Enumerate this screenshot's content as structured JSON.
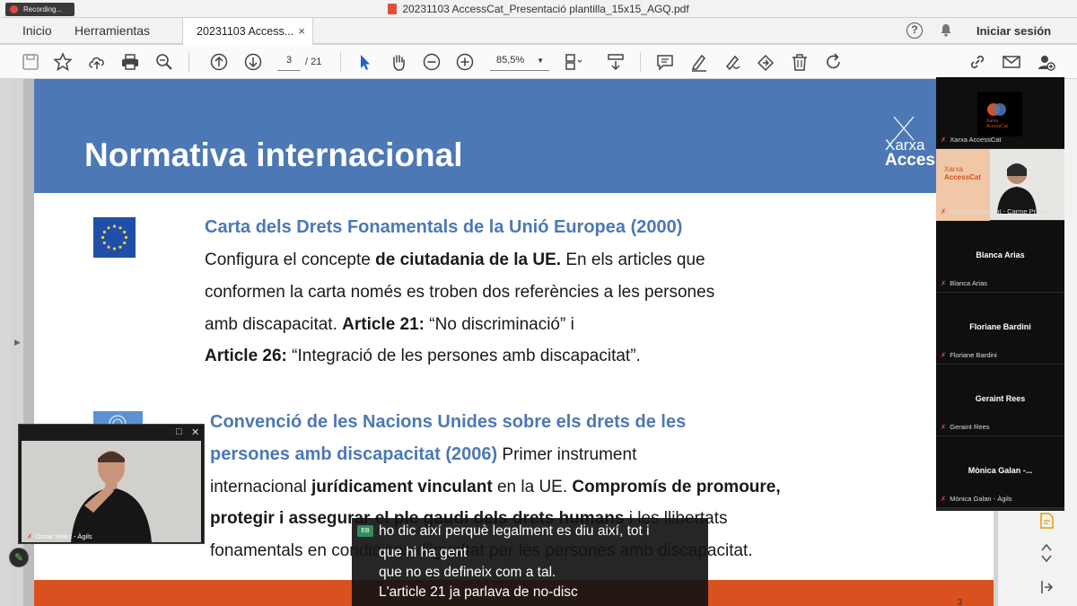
{
  "recording": {
    "label": "Recording..."
  },
  "window": {
    "title": "20231103 AccessCat_Presentació plantilla_15x15_AGQ.pdf"
  },
  "menu": {
    "home": "Inicio",
    "tools": "Herramientas",
    "doc_tab": "20231103 Access...",
    "close_tab": "×",
    "help": "?",
    "sign_in": "Iniciar sesión"
  },
  "toolbar": {
    "page_current": "3",
    "page_total": "/ 21",
    "zoom": "85,5%"
  },
  "slide": {
    "title": "Normativa internacional",
    "logo_line1": "Xarxa",
    "logo_line2": "Access",
    "section1": {
      "title": "Carta dels Drets Fonamentals de la Unió Europea (2000)",
      "l1a": "Configura el concepte ",
      "l1b": "de ciutadania de la UE.",
      "l1c": " En els articles que",
      "l2": "conformen la carta només es troben dos referències a les persones",
      "l3a": "amb discapacitat. ",
      "l3b": "Article 21:",
      "l3c": " “No discriminació” i",
      "l4a": "Article 26:",
      "l4b": " “Integració de les persones amb discapacitat”."
    },
    "section2": {
      "title1": "Convenció de les Nacions Unides sobre els drets de les",
      "title2": "persones amb discapacitat (2006)",
      "l2rest": " Primer instrument",
      "l3a": "internacional ",
      "l3b": "jurídicament vinculant",
      "l3c": " en la UE. ",
      "l3d": "Compromís de promoure,",
      "l4a": "protegir i assegurar el ple gaudi dels drets humans",
      "l4b": " i les llibertats",
      "l5": "fonamentals en condicions d'igualtat per les persones amb discapacitat."
    },
    "page_number": "3"
  },
  "participants": [
    {
      "tag": "Xarxa AccessCat"
    },
    {
      "tag": "Xarxa AccessCat - Carme Pratde..."
    },
    {
      "name": "Blanca Arias",
      "tag": "Blanca Arias"
    },
    {
      "name": "Floriane Bardini",
      "tag": "Floriane Bardini"
    },
    {
      "name": "Geraint Rees",
      "tag": "Geraint Rees"
    },
    {
      "name": "Mònica Galan -...",
      "tag": "Mònica Galan - Àgils"
    }
  ],
  "participant_logo": {
    "line1": "Xarxa",
    "line2": "AccessCat"
  },
  "video": {
    "name": "Oscar Velez - Àgils"
  },
  "captions": {
    "badge": "EB",
    "lines": [
      "ho dic així perquè legalment es diu així, tot i",
      "que hi ha gent",
      "que no es defineix com a tal.",
      "L'article 21 ja parlava de no-disc"
    ]
  },
  "colors": {
    "slide_blue": "#4c78b5",
    "footer_orange": "#d8511e",
    "mic_muted": "#e04a3a"
  }
}
